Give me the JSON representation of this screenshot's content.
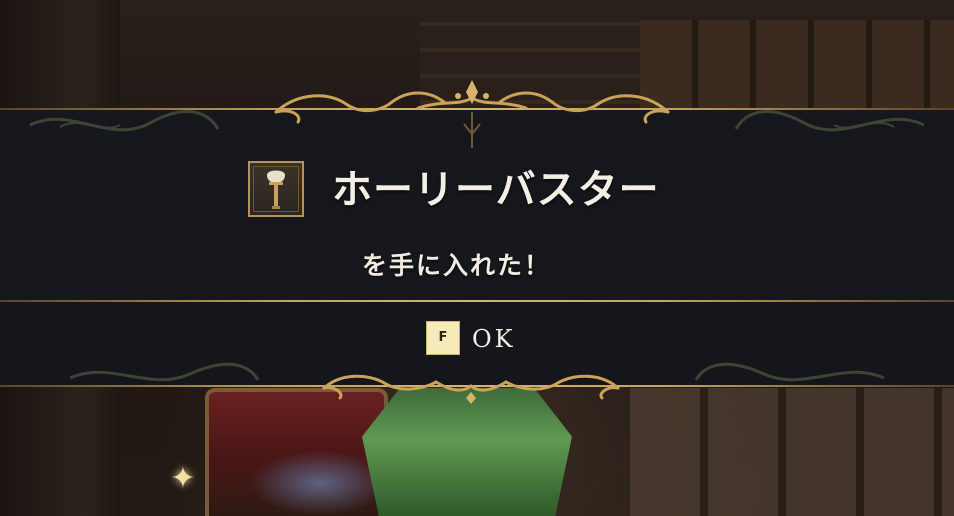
{
  "dialog": {
    "item_name": "ホーリーバスター",
    "message": "を手に入れた！",
    "item_icon": "torch-wand-icon"
  },
  "confirm": {
    "key": "F",
    "label": "OK"
  },
  "colors": {
    "gold": "#c9a15a",
    "banner": "#16181e",
    "text": "#f4efe4",
    "key_badge": "#f7ebb9"
  }
}
